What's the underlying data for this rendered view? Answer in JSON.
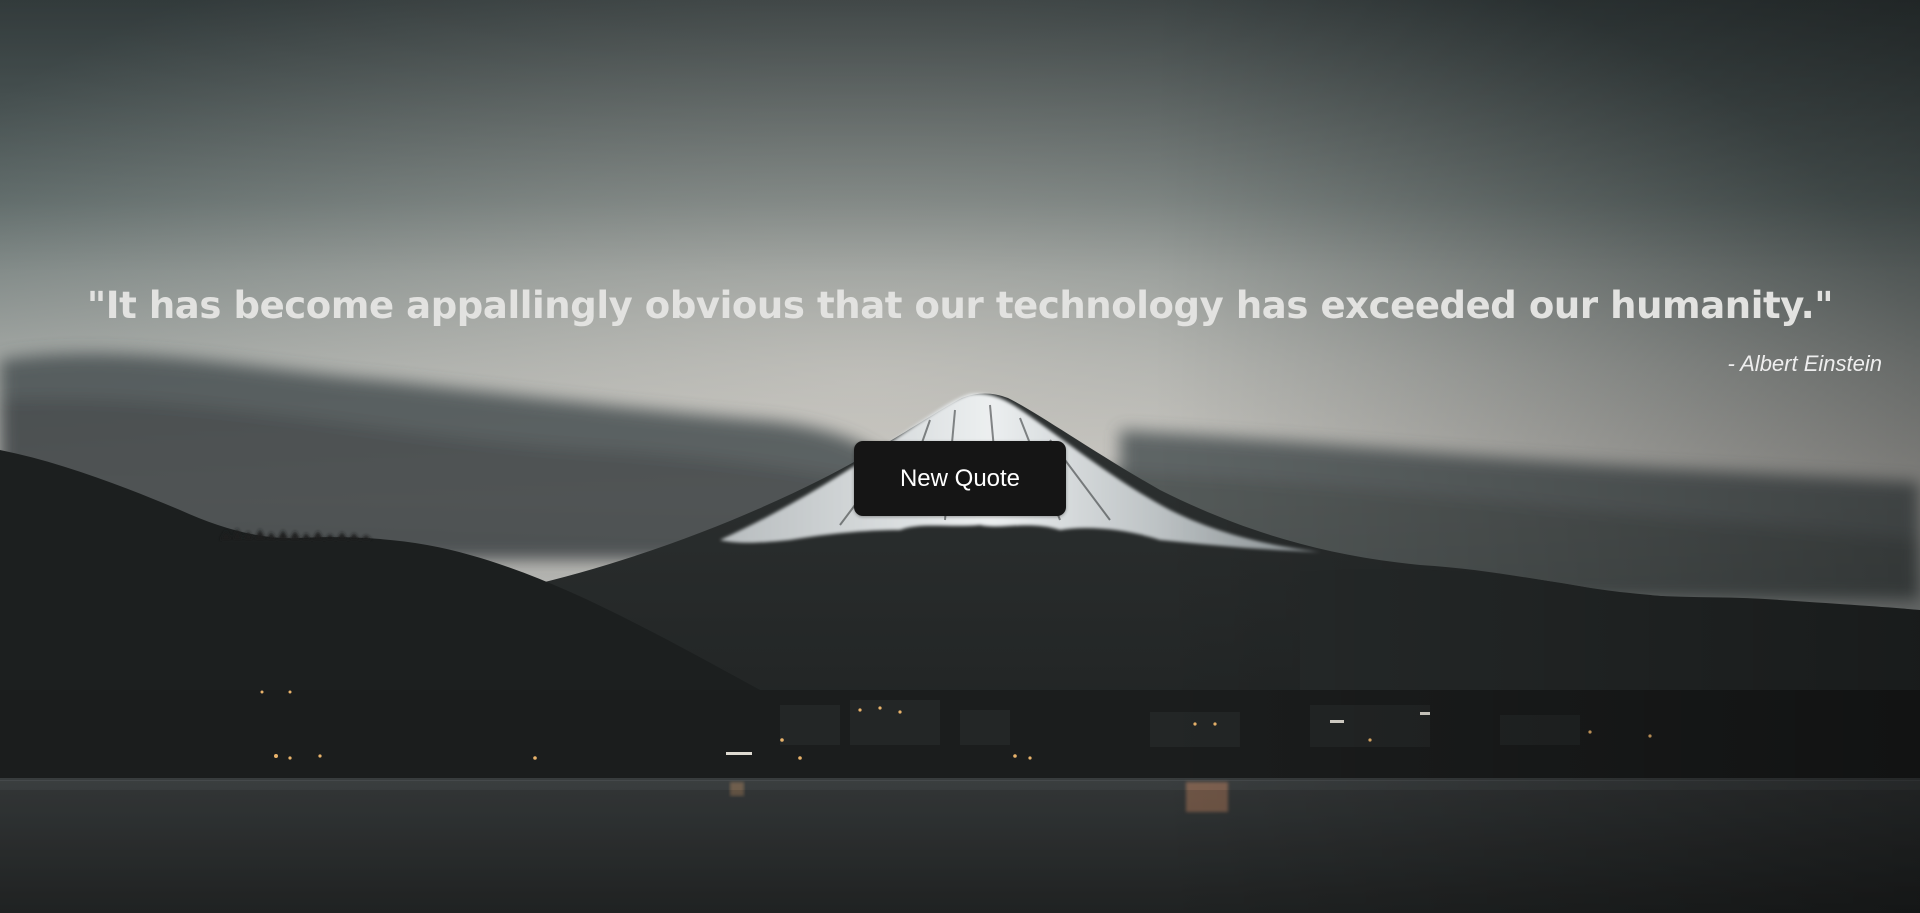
{
  "quote": {
    "text": "\"It has become appallingly obvious that our technology has exceeded our humanity.\"",
    "author": "- Albert Einstein"
  },
  "controls": {
    "new_quote_label": "New Quote"
  },
  "background": {
    "description_icon": "mountain-landscape-image",
    "sky_top": "#4b5657",
    "sky_horizon": "#c7c5c0",
    "mountain_dark": "#242727",
    "snow": "#e4e6e7",
    "water": "#2c2f30"
  }
}
